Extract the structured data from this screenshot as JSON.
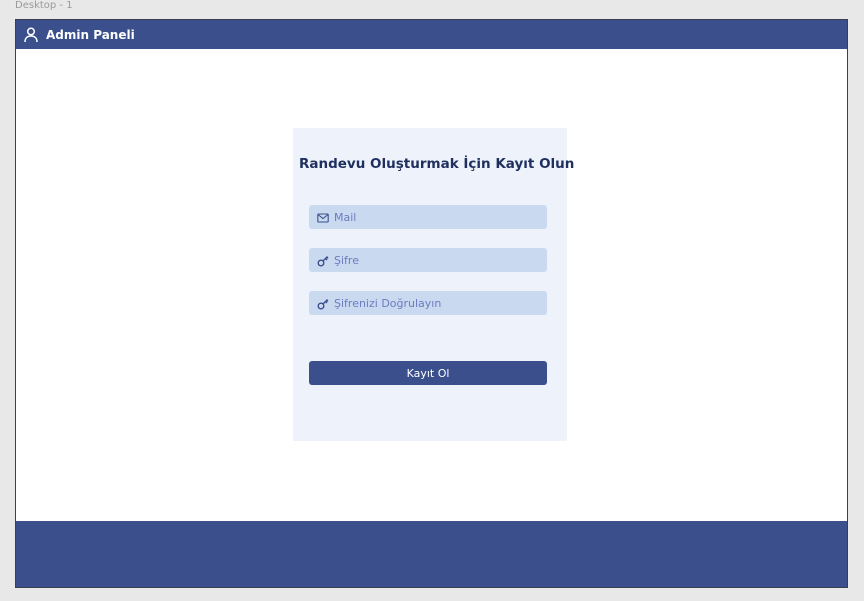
{
  "frame": {
    "label": "Desktop - 1"
  },
  "header": {
    "title": "Admin Paneli",
    "icon": "user-icon"
  },
  "card": {
    "title": "Randevu Oluşturmak İçin Kayıt Olun",
    "fields": [
      {
        "placeholder": "Mail",
        "icon": "mail-icon"
      },
      {
        "placeholder": "Şifre",
        "icon": "key-icon"
      },
      {
        "placeholder": "Şifrenizi Doğrulayın",
        "icon": "key-icon"
      }
    ],
    "submit_label": "Kayıt Ol"
  },
  "colors": {
    "primary": "#3a4f8c",
    "card_bg": "#eef3fb",
    "field_bg": "#c9daf0",
    "field_text": "#6b7bc0",
    "title_text": "#1f2f5e"
  }
}
